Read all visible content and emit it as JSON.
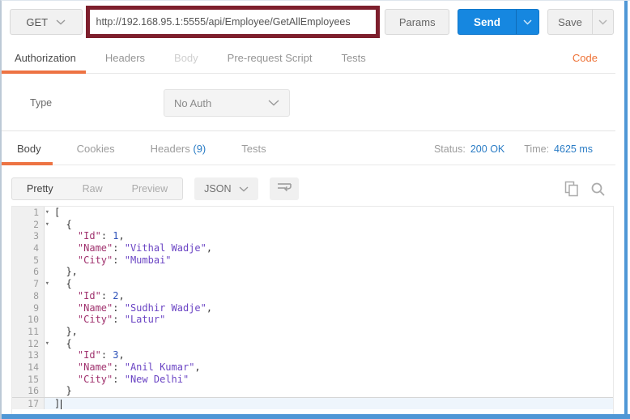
{
  "request_bar": {
    "method": "GET",
    "url": "http://192.168.95.1:5555/api/Employee/GetAllEmployees",
    "params_label": "Params",
    "send_label": "Send",
    "save_label": "Save"
  },
  "request_tabs": {
    "items": [
      {
        "label": "Authorization",
        "state": "active"
      },
      {
        "label": "Headers",
        "state": "normal"
      },
      {
        "label": "Body",
        "state": "dim"
      },
      {
        "label": "Pre-request Script",
        "state": "normal"
      },
      {
        "label": "Tests",
        "state": "normal"
      }
    ],
    "code_link": "Code"
  },
  "auth": {
    "type_label": "Type",
    "type_value": "No Auth"
  },
  "response_tabs": {
    "items": [
      {
        "label": "Body",
        "state": "active"
      },
      {
        "label": "Cookies",
        "state": "normal"
      },
      {
        "label": "Headers",
        "count": "(9)",
        "state": "normal"
      },
      {
        "label": "Tests",
        "state": "normal"
      }
    ],
    "status_label": "Status:",
    "status_value": "200 OK",
    "time_label": "Time:",
    "time_value": "4625 ms"
  },
  "viewer_toolbar": {
    "modes": [
      "Pretty",
      "Raw",
      "Preview"
    ],
    "active_mode": "Pretty",
    "language": "JSON",
    "icons": [
      "wrap-text-icon",
      "copy-icon",
      "search-icon"
    ]
  },
  "colors": {
    "accent_orange": "#ed7343",
    "link_blue": "#2a7cc5",
    "send_blue": "#1687e0",
    "url_highlight_maroon": "#7e1f2d",
    "frame_blue": "#4f97d6",
    "syntax_key": "#a0326e",
    "syntax_string": "#6b45c4",
    "syntax_number": "#2c50b8"
  },
  "editor": {
    "lines": [
      {
        "n": 1,
        "fold": true,
        "t": [
          [
            "p",
            "["
          ]
        ]
      },
      {
        "n": 2,
        "fold": true,
        "t": [
          [
            "p",
            "  {"
          ]
        ]
      },
      {
        "n": 3,
        "fold": false,
        "t": [
          [
            "p",
            "    "
          ],
          [
            "k",
            "\"Id\""
          ],
          [
            "p",
            ": "
          ],
          [
            "n2",
            "1"
          ],
          [
            "p",
            ","
          ]
        ]
      },
      {
        "n": 4,
        "fold": false,
        "t": [
          [
            "p",
            "    "
          ],
          [
            "k",
            "\"Name\""
          ],
          [
            "p",
            ": "
          ],
          [
            "s",
            "\"Vithal Wadje\""
          ],
          [
            "p",
            ","
          ]
        ]
      },
      {
        "n": 5,
        "fold": false,
        "t": [
          [
            "p",
            "    "
          ],
          [
            "k",
            "\"City\""
          ],
          [
            "p",
            ": "
          ],
          [
            "s",
            "\"Mumbai\""
          ]
        ]
      },
      {
        "n": 6,
        "fold": false,
        "t": [
          [
            "p",
            "  },"
          ]
        ]
      },
      {
        "n": 7,
        "fold": true,
        "t": [
          [
            "p",
            "  {"
          ]
        ]
      },
      {
        "n": 8,
        "fold": false,
        "t": [
          [
            "p",
            "    "
          ],
          [
            "k",
            "\"Id\""
          ],
          [
            "p",
            ": "
          ],
          [
            "n2",
            "2"
          ],
          [
            "p",
            ","
          ]
        ]
      },
      {
        "n": 9,
        "fold": false,
        "t": [
          [
            "p",
            "    "
          ],
          [
            "k",
            "\"Name\""
          ],
          [
            "p",
            ": "
          ],
          [
            "s",
            "\"Sudhir Wadje\""
          ],
          [
            "p",
            ","
          ]
        ]
      },
      {
        "n": 10,
        "fold": false,
        "t": [
          [
            "p",
            "    "
          ],
          [
            "k",
            "\"City\""
          ],
          [
            "p",
            ": "
          ],
          [
            "s",
            "\"Latur\""
          ]
        ]
      },
      {
        "n": 11,
        "fold": false,
        "t": [
          [
            "p",
            "  },"
          ]
        ]
      },
      {
        "n": 12,
        "fold": true,
        "t": [
          [
            "p",
            "  {"
          ]
        ]
      },
      {
        "n": 13,
        "fold": false,
        "t": [
          [
            "p",
            "    "
          ],
          [
            "k",
            "\"Id\""
          ],
          [
            "p",
            ": "
          ],
          [
            "n2",
            "3"
          ],
          [
            "p",
            ","
          ]
        ]
      },
      {
        "n": 14,
        "fold": false,
        "t": [
          [
            "p",
            "    "
          ],
          [
            "k",
            "\"Name\""
          ],
          [
            "p",
            ": "
          ],
          [
            "s",
            "\"Anil Kumar\""
          ],
          [
            "p",
            ","
          ]
        ]
      },
      {
        "n": 15,
        "fold": false,
        "t": [
          [
            "p",
            "    "
          ],
          [
            "k",
            "\"City\""
          ],
          [
            "p",
            ": "
          ],
          [
            "s",
            "\"New Delhi\""
          ]
        ]
      },
      {
        "n": 16,
        "fold": false,
        "t": [
          [
            "p",
            "  }"
          ]
        ]
      },
      {
        "n": 17,
        "fold": false,
        "cursor": true,
        "active": true,
        "t": [
          [
            "p",
            "]"
          ]
        ]
      }
    ]
  }
}
